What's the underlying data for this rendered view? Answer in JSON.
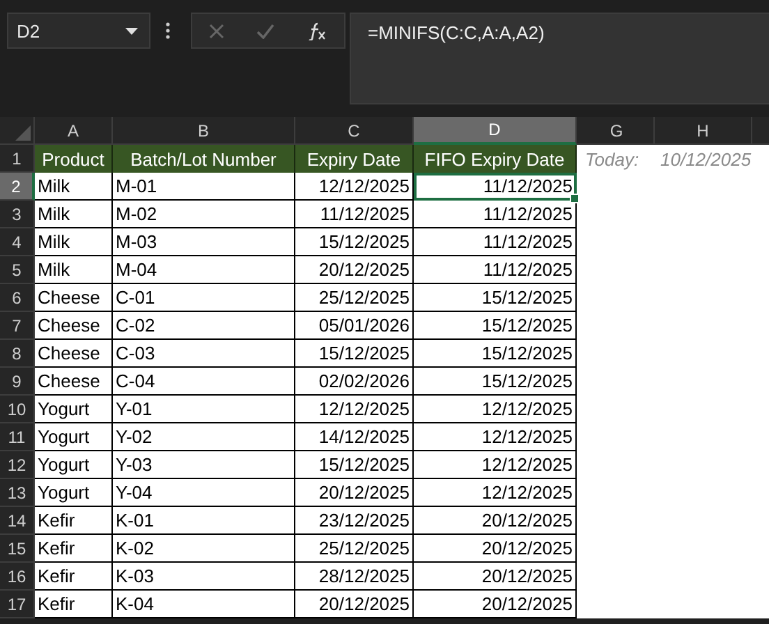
{
  "name_box": "D2",
  "formula": "=MINIFS(C:C,A:A,A2)",
  "columns": [
    {
      "label": "A",
      "selected": false
    },
    {
      "label": "B",
      "selected": false
    },
    {
      "label": "C",
      "selected": false
    },
    {
      "label": "D",
      "selected": true
    },
    {
      "label": "G",
      "selected": false
    },
    {
      "label": "H",
      "selected": false
    }
  ],
  "header_row": {
    "number": "1",
    "cells": [
      "Product",
      "Batch/Lot Number",
      "Expiry Date",
      "FIFO Expiry Date"
    ],
    "today_label": "Today:",
    "today_value": "10/12/2025"
  },
  "rows": [
    {
      "number": "2",
      "product": "Milk",
      "batch": "M-01",
      "expiry": "12/12/2025",
      "fifo": "11/12/2025",
      "selected": true
    },
    {
      "number": "3",
      "product": "Milk",
      "batch": "M-02",
      "expiry": "11/12/2025",
      "fifo": "11/12/2025",
      "selected": false
    },
    {
      "number": "4",
      "product": "Milk",
      "batch": "M-03",
      "expiry": "15/12/2025",
      "fifo": "11/12/2025",
      "selected": false
    },
    {
      "number": "5",
      "product": "Milk",
      "batch": "M-04",
      "expiry": "20/12/2025",
      "fifo": "11/12/2025",
      "selected": false
    },
    {
      "number": "6",
      "product": "Cheese",
      "batch": "C-01",
      "expiry": "25/12/2025",
      "fifo": "15/12/2025",
      "selected": false
    },
    {
      "number": "7",
      "product": "Cheese",
      "batch": "C-02",
      "expiry": "05/01/2026",
      "fifo": "15/12/2025",
      "selected": false
    },
    {
      "number": "8",
      "product": "Cheese",
      "batch": "C-03",
      "expiry": "15/12/2025",
      "fifo": "15/12/2025",
      "selected": false
    },
    {
      "number": "9",
      "product": "Cheese",
      "batch": "C-04",
      "expiry": "02/02/2026",
      "fifo": "15/12/2025",
      "selected": false
    },
    {
      "number": "10",
      "product": "Yogurt",
      "batch": "Y-01",
      "expiry": "12/12/2025",
      "fifo": "12/12/2025",
      "selected": false
    },
    {
      "number": "11",
      "product": "Yogurt",
      "batch": "Y-02",
      "expiry": "14/12/2025",
      "fifo": "12/12/2025",
      "selected": false
    },
    {
      "number": "12",
      "product": "Yogurt",
      "batch": "Y-03",
      "expiry": "15/12/2025",
      "fifo": "12/12/2025",
      "selected": false
    },
    {
      "number": "13",
      "product": "Yogurt",
      "batch": "Y-04",
      "expiry": "20/12/2025",
      "fifo": "12/12/2025",
      "selected": false
    },
    {
      "number": "14",
      "product": "Kefir",
      "batch": "K-01",
      "expiry": "23/12/2025",
      "fifo": "20/12/2025",
      "selected": false
    },
    {
      "number": "15",
      "product": "Kefir",
      "batch": "K-02",
      "expiry": "25/12/2025",
      "fifo": "20/12/2025",
      "selected": false
    },
    {
      "number": "16",
      "product": "Kefir",
      "batch": "K-03",
      "expiry": "28/12/2025",
      "fifo": "20/12/2025",
      "selected": false
    },
    {
      "number": "17",
      "product": "Kefir",
      "batch": "K-04",
      "expiry": "20/12/2025",
      "fifo": "20/12/2025",
      "selected": false
    }
  ]
}
